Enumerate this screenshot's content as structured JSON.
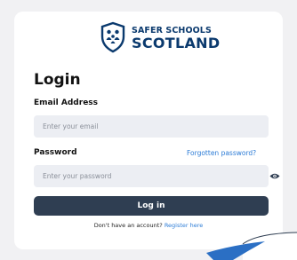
{
  "brand": {
    "line1": "SAFER SCHOOLS",
    "line2": "SCOTLAND",
    "logo_icon": "shield-family-icon"
  },
  "login": {
    "title": "Login",
    "email_label": "Email Address",
    "email_placeholder": "Enter your email",
    "email_value": "",
    "password_label": "Password",
    "password_placeholder": "Enter your password",
    "password_value": "",
    "forgot_link": "Forgotten password?",
    "toggle_icon": "eye-icon",
    "submit_label": "Log in",
    "footer_text": "Don't have an account?",
    "register_link": "Register here"
  },
  "colors": {
    "brand": "#0b3a6e",
    "button": "#2f3e52",
    "link": "#2b7bd6",
    "input_bg": "#eceef3",
    "page_bg": "#f1f1f3"
  }
}
